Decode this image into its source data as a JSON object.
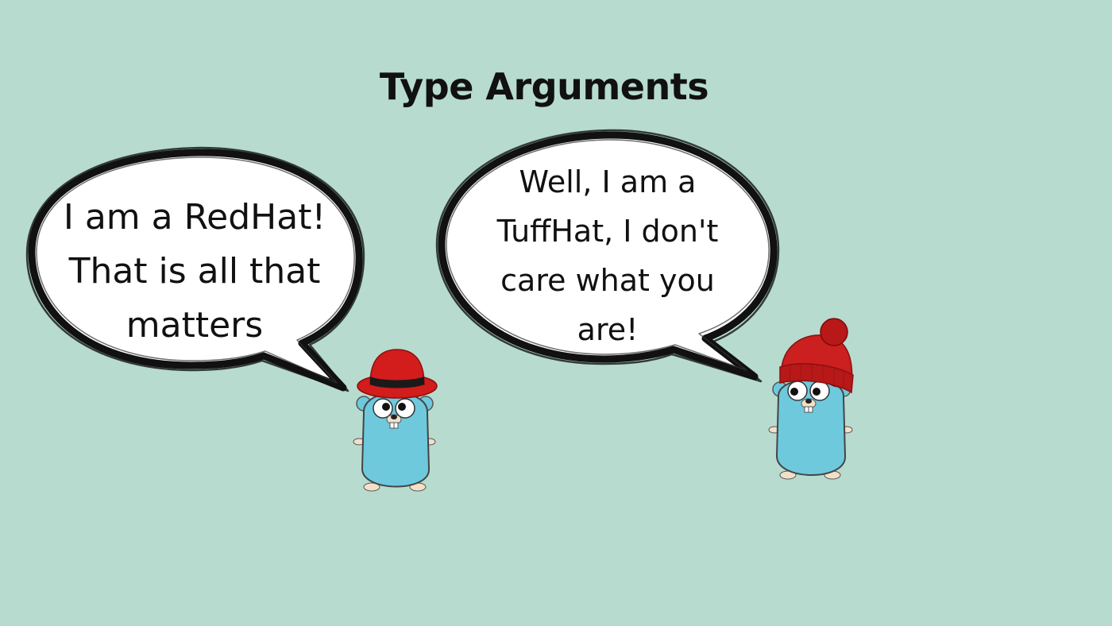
{
  "title": "Type Arguments",
  "colors": {
    "background": "#b7dbcf",
    "bubble_fill": "#ffffff",
    "bubble_outline": "#111111",
    "gopher_body": "#6ec9dd",
    "hat_red": "#d31c1c",
    "hat_band": "#1a1a1a",
    "beanie_red": "#cc1f1f"
  },
  "left_bubble": {
    "lines": [
      "I am a RedHat!",
      "That is all that",
      "matters"
    ]
  },
  "right_bubble": {
    "lines": [
      "Well, I am a",
      "TuffHat, I don't",
      "care what you",
      "are!"
    ]
  },
  "icons": [
    "redhat-gopher-icon",
    "beanie-gopher-icon",
    "speech-bubble-icon"
  ]
}
